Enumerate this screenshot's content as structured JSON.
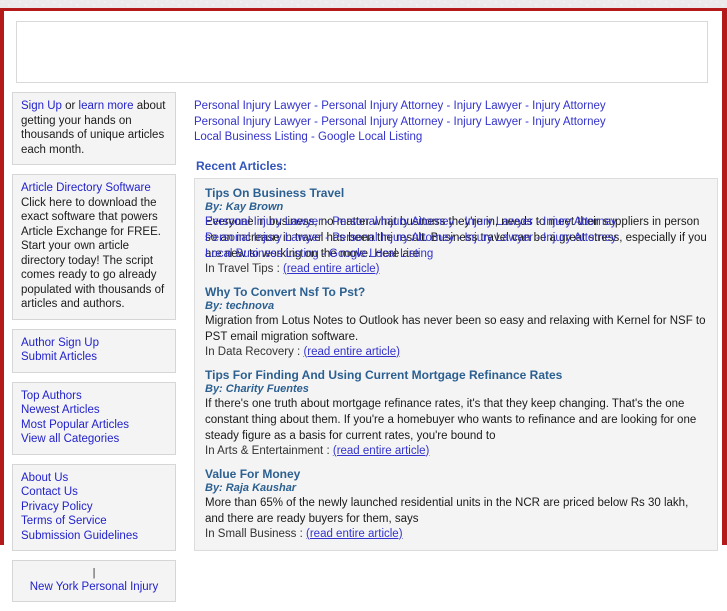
{
  "top_links": {
    "line1": [
      "Personal Injury Lawyer",
      "Personal Injury Attorney",
      "Injury Lawyer",
      "Injury Attorney"
    ],
    "line2": [
      "Personal Injury Lawyer",
      "Personal Injury Attorney",
      "Injury Lawyer",
      "Injury Attorney"
    ],
    "line3": [
      "Local Business Listing",
      "Google Local Listing"
    ],
    "separator": " - "
  },
  "recent_heading": "Recent Articles:",
  "sidebar": {
    "signup_box": {
      "signup_link": "Sign Up",
      "or_text": " or ",
      "learn_more_link": "learn more",
      "rest_text": " about getting your hands on thousands of unique articles each month."
    },
    "software_box": {
      "title": "Article Directory Software",
      "body": "Click here to download the exact software that powers Article Exchange for FREE. Start your own article directory today! The script comes ready to go already populated with thousands of articles and authors."
    },
    "author_links": [
      "Author Sign Up",
      "Submit Articles"
    ],
    "browse_links": [
      "Top Authors",
      "Newest Articles",
      "Most Popular Articles",
      "View all Categories"
    ],
    "info_links": [
      "About Us",
      "Contact Us",
      "Privacy Policy",
      "Terms of Service",
      "Submission Guidelines"
    ],
    "ad_box": {
      "bar": "|",
      "link": "New York Personal Injury"
    }
  },
  "articles": [
    {
      "title": "Tips On Business Travel",
      "by_label": "By: ",
      "author": "Kay Brown",
      "body": "Everyone in business, no matter what business they're in, needs to meet their suppliers in person so an increase in travel has been the result. Business travel can be a great stress, especially if you are new to working on the move. Here are",
      "category_prefix": "In ",
      "category": "Travel Tips",
      "read_more": "(read entire article)",
      "overlap": {
        "line1": [
          "Personal Injury Lawyer",
          "Personal Injury Attorney",
          "Injury Lawyer",
          "Injury Attorney"
        ],
        "line2": [
          "Personal Injury Lawyer",
          "Personal Injury Attorney",
          "Injury Lawyer",
          "Injury Attorney"
        ],
        "line3": [
          "Local Business Listing",
          "Google Local Listing"
        ]
      }
    },
    {
      "title": "Why To Convert Nsf To Pst?",
      "by_label": "By: ",
      "author": "technova",
      "body": "Migration from Lotus Notes to Outlook has never been so easy and relaxing with Kernel for NSF to PST email migration software.",
      "category_prefix": "In ",
      "category": "Data Recovery",
      "read_more": "(read entire article)"
    },
    {
      "title": "Tips For Finding And Using Current Mortgage Refinance Rates",
      "by_label": "By: ",
      "author": "Charity Fuentes",
      "body": "If there's one truth about mortgage refinance rates, it's that they keep changing. That's the one constant thing about them. If you're a homebuyer who wants to refinance and are looking for one steady figure as a basis for current rates, you're bound to",
      "category_prefix": "In ",
      "category": "Arts & Entertainment",
      "read_more": "(read entire article)"
    },
    {
      "title": "Value For Money",
      "by_label": "By: ",
      "author": "Raja Kaushar",
      "body": "More than 65% of the newly launched residential units in the NCR are priced below Rs 30 lakh, and there are ready buyers for them, says",
      "category_prefix": "In ",
      "category": "Small Business",
      "read_more": "(read entire article)"
    }
  ],
  "colors": {
    "frame_red": "#b51a1a",
    "link_blue": "#3333cc",
    "title_blue": "#2c6091",
    "heading_blue": "#3355bb",
    "box_bg": "#f4f4f4"
  }
}
